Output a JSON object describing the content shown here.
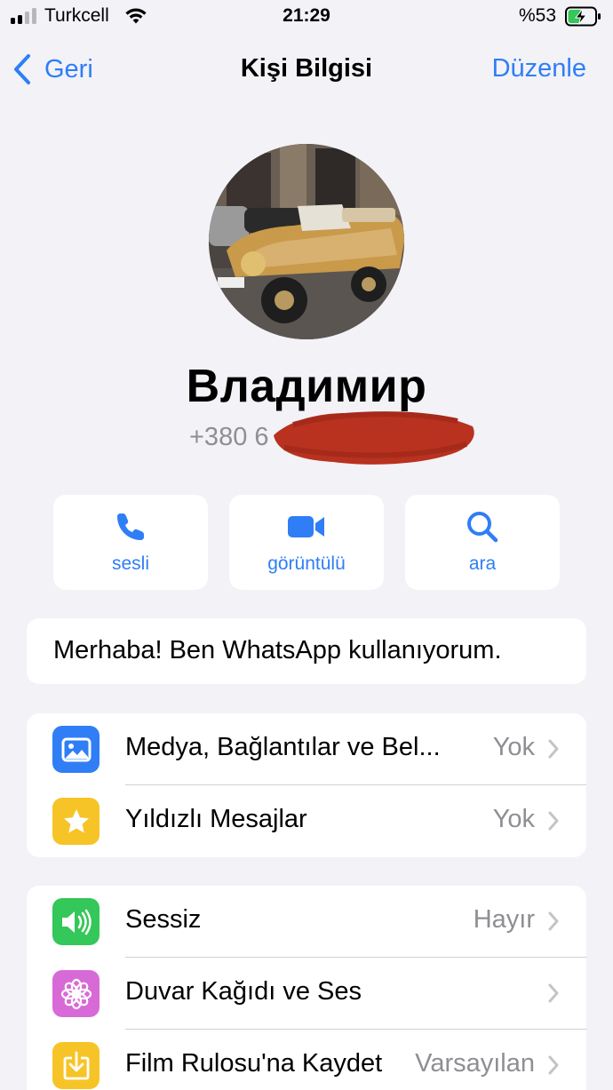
{
  "status_bar": {
    "carrier": "Turkcell",
    "time": "21:29",
    "battery_percent": "%53",
    "battery_level": 0.53,
    "charging": true
  },
  "nav": {
    "back_label": "Geri",
    "title": "Kişi Bilgisi",
    "edit_label": "Düzenle"
  },
  "contact": {
    "name": "Владимир",
    "phone_visible": "+380 6",
    "phone_redacted": true
  },
  "actions": [
    {
      "label": "sesli",
      "icon": "phone-icon"
    },
    {
      "label": "görüntülü",
      "icon": "video-camera-icon"
    },
    {
      "label": "ara",
      "icon": "search-icon"
    }
  ],
  "about": {
    "text": "Merhaba! Ben WhatsApp kullanıyorum."
  },
  "groups": {
    "media": [
      {
        "title": "Medya, Bağlantılar ve Bel...",
        "value": "Yok",
        "icon": "photo-icon",
        "color": "#2f7ef6"
      },
      {
        "title": "Yıldızlı Mesajlar",
        "value": "Yok",
        "icon": "star-icon",
        "color": "#f7c427"
      }
    ],
    "settings": [
      {
        "title": "Sessiz",
        "value": "Hayır",
        "icon": "speaker-icon",
        "color": "#34c759"
      },
      {
        "title": "Duvar Kağıdı ve Ses",
        "value": "",
        "icon": "flower-icon",
        "color": "#d86ad8"
      },
      {
        "title": "Film Rulosu'na Kaydet",
        "value": "Varsayılan",
        "icon": "download-icon",
        "color": "#f7c427"
      }
    ]
  },
  "colors": {
    "accent": "#2f7ef6",
    "background": "#f2f2f7",
    "secondary_text": "#8e8e93",
    "redaction": "#b9311f"
  }
}
